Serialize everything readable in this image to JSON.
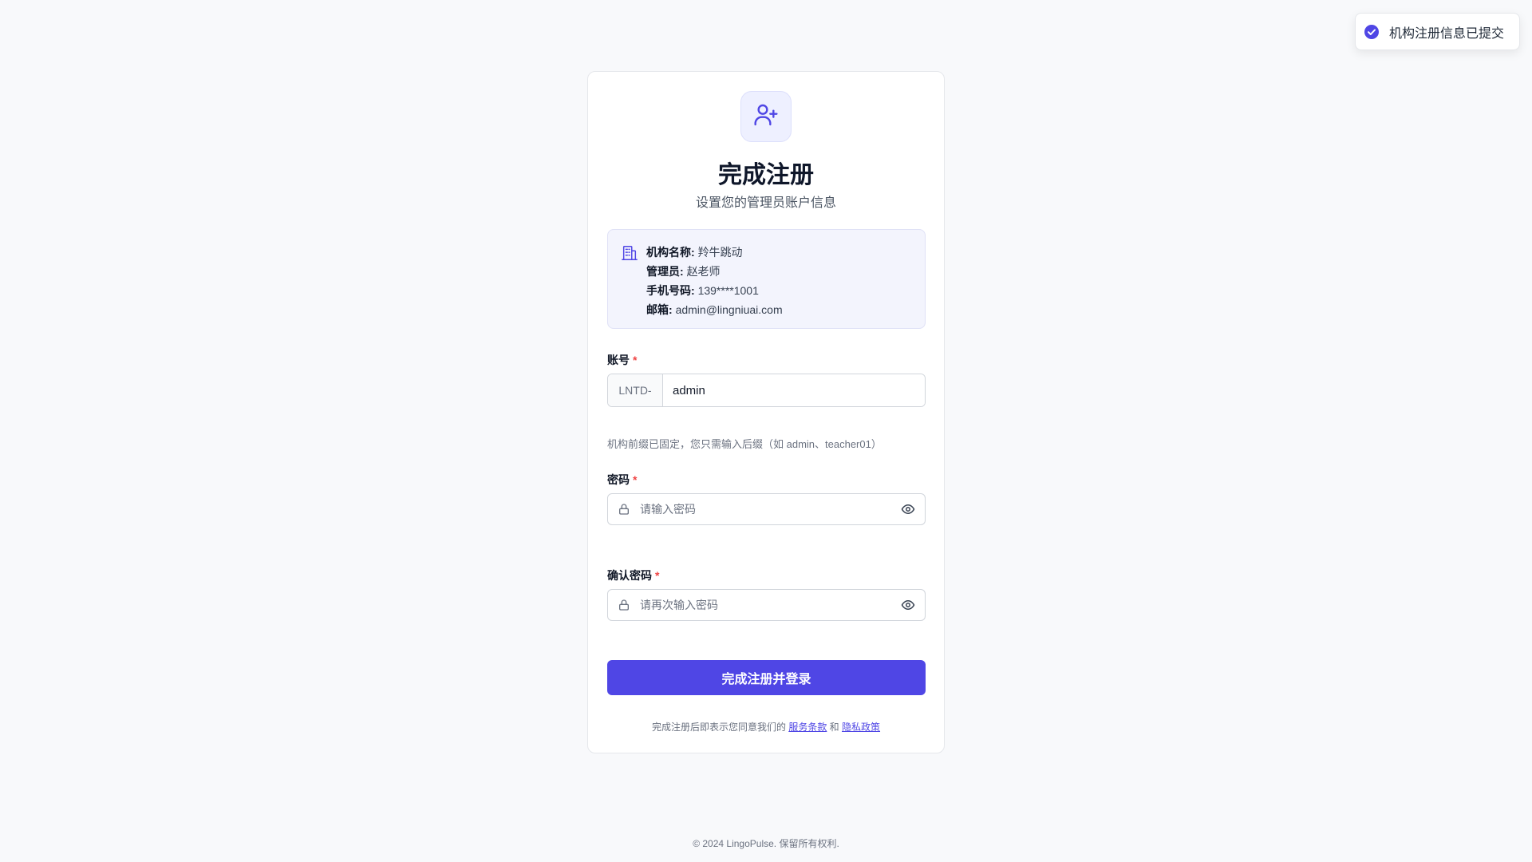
{
  "toast": {
    "message": "机构注册信息已提交",
    "icon": "check-circle-icon",
    "color": "#4f46e5"
  },
  "header": {
    "icon": "user-plus-icon",
    "title": "完成注册",
    "subtitle": "设置您的管理员账户信息"
  },
  "org_info": {
    "icon": "building-icon",
    "name_label": "机构名称:",
    "name_value": "羚牛跳动",
    "admin_label": "管理员:",
    "admin_value": "赵老师",
    "phone_label": "手机号码:",
    "phone_value": "139****1001",
    "email_label": "邮箱:",
    "email_value": "admin@lingniuai.com"
  },
  "account": {
    "label": "账号",
    "required_mark": "*",
    "prefix": "LNTD-",
    "value": "admin",
    "hint": "机构前缀已固定，您只需输入后缀（如 admin、teacher01）"
  },
  "password": {
    "label": "密码",
    "required_mark": "*",
    "placeholder": "请输入密码"
  },
  "confirm_password": {
    "label": "确认密码",
    "required_mark": "*",
    "placeholder": "请再次输入密码"
  },
  "submit_label": "完成注册并登录",
  "terms": {
    "prefix": "完成注册后即表示您同意我们的",
    "service_link": "服务条款",
    "and": "和",
    "privacy_link": "隐私政策"
  },
  "footer": "© 2024 LingoPulse. 保留所有权利.",
  "colors": {
    "accent": "#4f46e5",
    "required": "#ef4444",
    "background": "#f8f9fb"
  }
}
